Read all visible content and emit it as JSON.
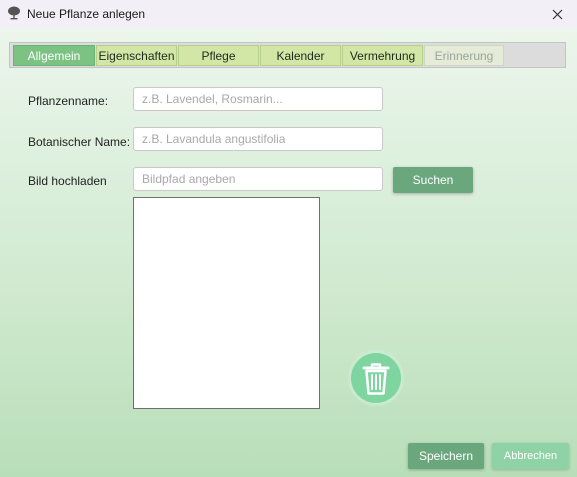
{
  "window": {
    "title": "Neue Pflanze anlegen",
    "icon": "plant-icon",
    "close_icon": "close-icon"
  },
  "tabs": [
    {
      "label": "Allgemein",
      "state": "active"
    },
    {
      "label": "Eigenschaften",
      "state": "normal"
    },
    {
      "label": "Pflege",
      "state": "normal"
    },
    {
      "label": "Kalender",
      "state": "normal"
    },
    {
      "label": "Vermehrung",
      "state": "normal"
    },
    {
      "label": "Erinnerung",
      "state": "disabled"
    }
  ],
  "form": {
    "plant_name": {
      "label": "Pflanzenname:",
      "value": "",
      "placeholder": "z.B. Lavendel, Rosmarin..."
    },
    "botanical_name": {
      "label": "Botanischer Name:",
      "value": "",
      "placeholder": "z.B. Lavandula angustifolia"
    },
    "image_upload": {
      "label": "Bild hochladen",
      "value": "",
      "placeholder": "Bildpfad angeben",
      "button_label": "Suchen"
    }
  },
  "delete_image": {
    "icon": "trash-icon"
  },
  "footer": {
    "save_label": "Speichern",
    "cancel_label": "Abbrechen"
  },
  "colors": {
    "tab_active": "#7cc383",
    "tab_inactive": "#d2e7a6",
    "primary_button": "#6aa77c",
    "secondary_button": "#8fd2a6",
    "trash_circle": "#7fd5a0"
  }
}
